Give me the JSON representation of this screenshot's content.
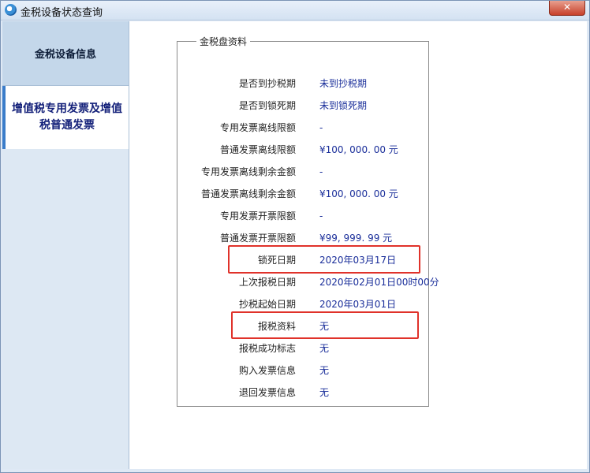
{
  "window": {
    "title": "金税设备状态查询",
    "close_glyph": "✕"
  },
  "sidebar": {
    "items": [
      {
        "label": "金税设备信息"
      },
      {
        "label": "增值税专用发票及增值税普通发票"
      }
    ]
  },
  "panel": {
    "legend": "金税盘资料",
    "rows": [
      {
        "label": "是否到抄税期",
        "value": "未到抄税期"
      },
      {
        "label": "是否到锁死期",
        "value": "未到锁死期"
      },
      {
        "label": "专用发票离线限额",
        "value": "-"
      },
      {
        "label": "普通发票离线限额",
        "value": "¥100, 000. 00 元"
      },
      {
        "label": "专用发票离线剩余金额",
        "value": "-"
      },
      {
        "label": "普通发票离线剩余金额",
        "value": "¥100, 000. 00 元"
      },
      {
        "label": "专用发票开票限额",
        "value": "-"
      },
      {
        "label": "普通发票开票限额",
        "value": "¥99, 999. 99 元"
      },
      {
        "label": "锁死日期",
        "value": "2020年03月17日"
      },
      {
        "label": "上次报税日期",
        "value": "2020年02月01日00时00分"
      },
      {
        "label": "抄税起始日期",
        "value": "2020年03月01日"
      },
      {
        "label": "报税资料",
        "value": "无"
      },
      {
        "label": "报税成功标志",
        "value": "无"
      },
      {
        "label": "购入发票信息",
        "value": "无"
      },
      {
        "label": "退回发票信息",
        "value": "无"
      }
    ]
  },
  "colors": {
    "highlight": "#e0322a",
    "value_text": "#1a2e9a"
  }
}
